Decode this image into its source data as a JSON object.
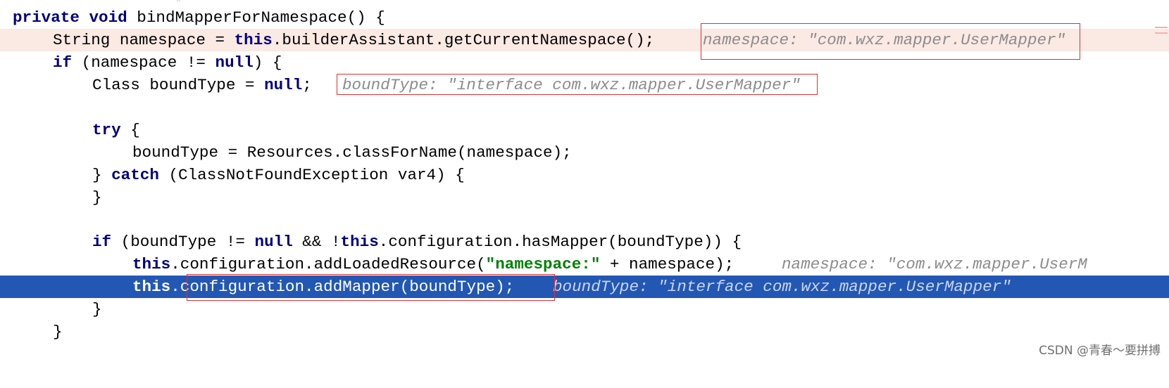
{
  "method": {
    "signature": {
      "mod1": "private",
      "mod2": "void",
      "rest": " bindMapperForNamespace() {"
    },
    "line2": {
      "type": "String namespace = ",
      "kw": "this",
      "rest": ".builderAssistant.getCurrentNamespace();",
      "hint": "namespace: \"com.wxz.mapper.UserMapper\""
    },
    "line3": {
      "kw": "if",
      "a": " (namespace != ",
      "kw2": "null",
      "b": ") {"
    },
    "line4": {
      "a": "Class boundType = ",
      "kw": "null",
      "b": ";",
      "hint": "boundType: \"interface com.wxz.mapper.UserMapper\""
    },
    "line6": {
      "kw": "try",
      "b": " {"
    },
    "line7": {
      "text": "boundType = Resources.classForName(namespace);"
    },
    "line8": {
      "a": "} ",
      "kw": "catch",
      "b": " (ClassNotFoundException var4) {"
    },
    "line9": {
      "text": "}"
    },
    "line11": {
      "kw": "if",
      "a": " (boundType != ",
      "kw2": "null",
      "b": " && !",
      "kw3": "this",
      "c": ".configuration.hasMapper(boundType)) {"
    },
    "line12": {
      "kw": "this",
      "a": ".configuration.addLoadedResource(",
      "str": "\"namespace:\"",
      "b": " + namespace);",
      "hint": "namespace: \"com.wxz.mapper.UserM"
    },
    "line13": {
      "kw": "this",
      "a": ".configuration.addMapper(boundType);",
      "hint": "boundType: \"interface com.wxz.mapper.UserMapper\""
    },
    "line14": {
      "text": "}"
    },
    "line15": {
      "text": "}"
    }
  },
  "watermark": "CSDN @青春～要拼搏"
}
